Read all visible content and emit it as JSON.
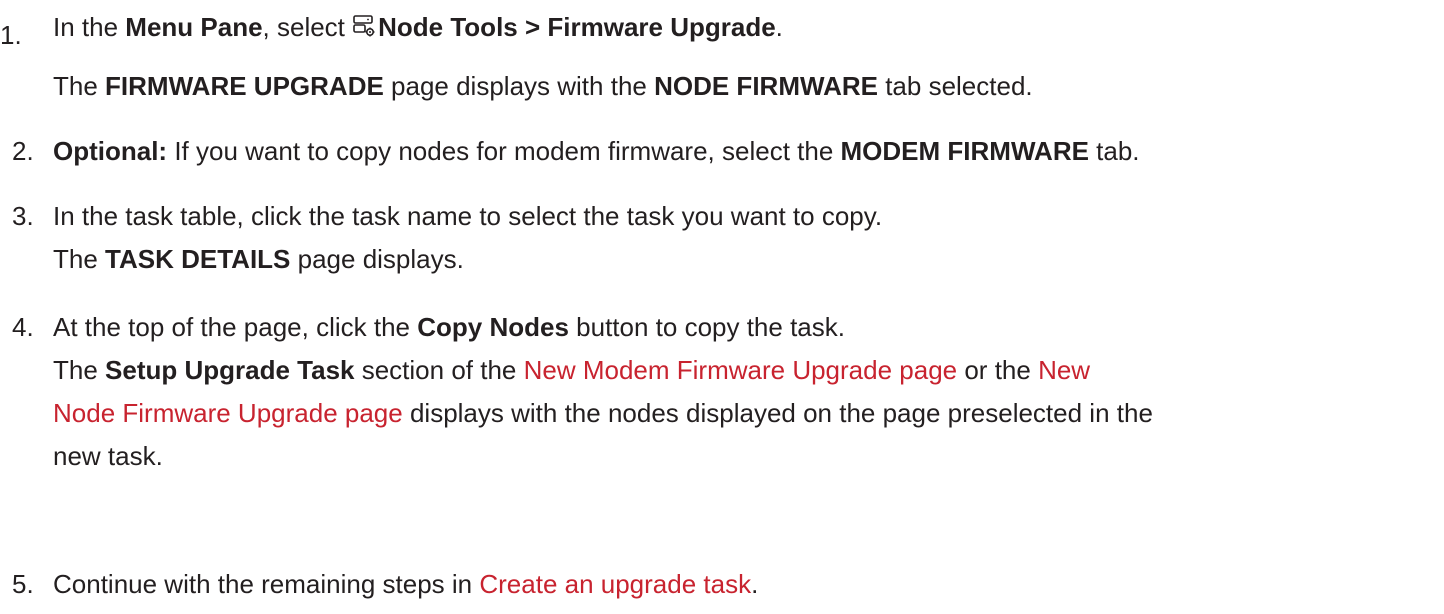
{
  "steps": [
    {
      "number": "1.",
      "pre": "In the ",
      "b1": "Menu Pane",
      "mid": ", select ",
      "icon": "node-tools-icon",
      "b2": "Node Tools > Firmware Upgrade",
      "post": ".",
      "result_pre": "The ",
      "result_b1": "FIRMWARE UPGRADE",
      "result_mid": " page displays with the ",
      "result_b2": "NODE FIRMWARE",
      "result_post": " tab selected."
    },
    {
      "number": "2.",
      "b1": "Optional:",
      "mid": " If you want to copy nodes for modem firmware, select the ",
      "b2": "MODEM FIRMWARE",
      "post": " tab."
    },
    {
      "number": "3.",
      "text": "In the task table, click the task name to select the task you want to copy.",
      "result_pre": "The ",
      "result_b1": "TASK DETAILS",
      "result_post": " page displays."
    },
    {
      "number": "4.",
      "pre": "At the top of the page, click the ",
      "b1": "Copy Nodes",
      "post": " button to copy the task.",
      "result_pre": "The ",
      "result_b1": "Setup Upgrade Task",
      "result_mid": " section of the ",
      "result_link1": "New Modem Firmware Upgrade page",
      "result_mid2": " or the ",
      "result_link2_a": "New",
      "result_link2_b": "Node Firmware Upgrade page",
      "result_mid3": " displays with the nodes displayed on the page preselected in the",
      "result_end": "new task."
    },
    {
      "number": "5.",
      "pre": "Continue with the remaining steps in ",
      "link": "Create an upgrade task",
      "post": "."
    }
  ]
}
